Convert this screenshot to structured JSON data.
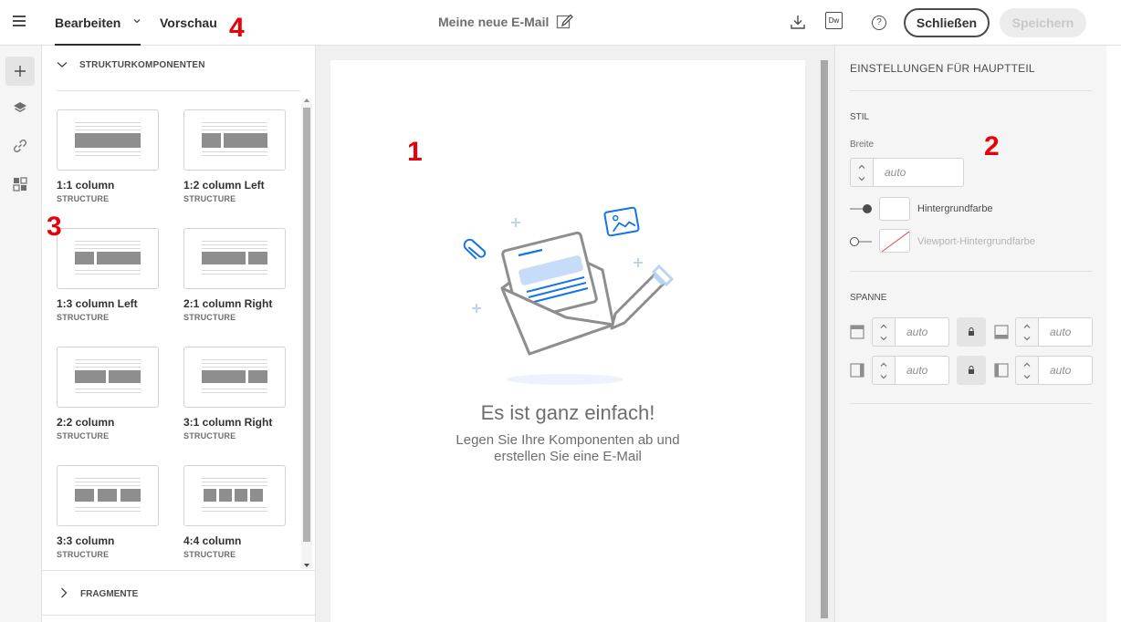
{
  "annotations": {
    "canvas": "1",
    "settings": "2",
    "components": "3",
    "tabs": "4"
  },
  "header": {
    "tabs": [
      {
        "label": "Bearbeiten"
      },
      {
        "label": "Vorschau"
      }
    ],
    "document_title": "Meine neue E-Mail",
    "close_label": "Schließen",
    "save_label": "Speichern",
    "dw_label": "Dw",
    "help_label": "?"
  },
  "rail": {
    "items": [
      {
        "icon": "plus-icon",
        "active": true
      },
      {
        "icon": "layers-icon",
        "active": false
      },
      {
        "icon": "link-icon",
        "active": false
      },
      {
        "icon": "fragments-icon",
        "active": false
      }
    ]
  },
  "components": {
    "section_title": "STRUKTURKOMPONENTEN",
    "cards": [
      {
        "name": "1:1 column",
        "type": "STRUCTURE"
      },
      {
        "name": "1:2 column Left",
        "type": "STRUCTURE"
      },
      {
        "name": "1:3 column Left",
        "type": "STRUCTURE"
      },
      {
        "name": "2:1 column Right",
        "type": "STRUCTURE"
      },
      {
        "name": "2:2 column",
        "type": "STRUCTURE"
      },
      {
        "name": "3:1 column Right",
        "type": "STRUCTURE"
      },
      {
        "name": "3:3 column",
        "type": "STRUCTURE"
      },
      {
        "name": "4:4 column",
        "type": "STRUCTURE"
      }
    ],
    "fragments_title": "FRAGMENTE"
  },
  "canvas": {
    "empty_title": "Es ist ganz einfach!",
    "empty_subtitle": "Legen Sie Ihre Komponenten ab und erstellen Sie eine E-Mail"
  },
  "settings": {
    "title": "EINSTELLUNGEN FÜR HAUPTTEIL",
    "style_section": "STIL",
    "width_label": "Breite",
    "width_placeholder": "auto",
    "background_color_label": "Hintergrundfarbe",
    "viewport_background_label": "Viewport-Hintergrundfarbe",
    "padding_section": "SPANNE",
    "padding_placeholder": "auto"
  },
  "colors": {
    "annotation": "#e8000b",
    "accent_blue": "#1473e6",
    "save_disabled_bg": "#ececec"
  }
}
